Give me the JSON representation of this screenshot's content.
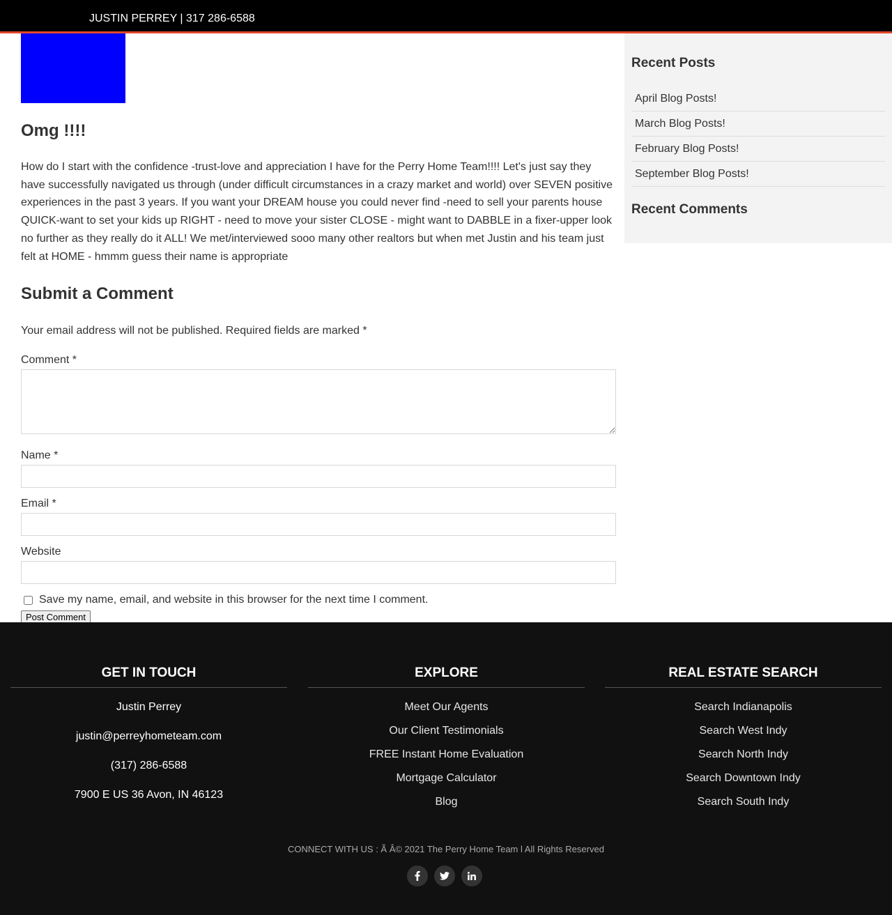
{
  "topbar": {
    "text": "JUSTIN PERREY | 317 286-6588"
  },
  "colors": {
    "topbar_bg": "#000000",
    "accent_line": "#e0482a",
    "featured_image": "#0000ff",
    "sidebar_bg": "#f3f3f3",
    "footer_bg": "#111111"
  },
  "post": {
    "title": "Omg !!!!",
    "body": "How do I start with the confidence -trust-love and appreciation I have for the Perry Home Team!!!! Let's just say they have successfully navigated us through (under difficult circumstances in a crazy market and world) over SEVEN positive experiences in the past 3 years. If you want your DREAM house you could never find -need to sell your parents house QUICK-want to set your kids up RIGHT - need to move your sister CLOSE - might want to DABBLE in a fixer-upper look no further as they really do it ALL! We met/interviewed sooo many other realtors but when met Justin and his team just felt at HOME - hmmm guess their name is appropriate"
  },
  "comment_form": {
    "title": "Submit a Comment",
    "notes": "Your email address will not be published. Required fields are marked *",
    "comment_label": "Comment *",
    "name_label": "Name *",
    "email_label": "Email *",
    "website_label": "Website",
    "consent_label": "Save my name, email, and website in this browser for the next time I comment.",
    "submit_label": "Post Comment"
  },
  "sidebar": {
    "recent_posts_title": "Recent Posts",
    "recent_posts": [
      "April Blog Posts!",
      "March Blog Posts!",
      "February Blog Posts!",
      "September Blog Posts!"
    ],
    "recent_comments_title": "Recent Comments"
  },
  "footer": {
    "col1": {
      "title": "GET IN TOUCH",
      "items": [
        "Justin Perrey",
        "justin@perreyhometeam.com",
        "(317) 286-6588",
        "7900 E US 36 Avon, IN 46123"
      ]
    },
    "col2": {
      "title": "EXPLORE",
      "items": [
        "Meet Our Agents",
        "Our Client Testimonials",
        "FREE Instant Home Evaluation",
        "Mortgage Calculator",
        "Blog"
      ]
    },
    "col3": {
      "title": "REAL ESTATE SEARCH",
      "items": [
        "Search Indianapolis",
        "Search West Indy",
        "Search North Indy",
        "Search Downtown Indy",
        "Search South Indy"
      ]
    },
    "bottom_text": "CONNECT WITH US : Ã    Â© 2021 The Perry Home Team l All Rights Reserved",
    "social": [
      "facebook-icon",
      "twitter-icon",
      "linkedin-icon"
    ]
  }
}
